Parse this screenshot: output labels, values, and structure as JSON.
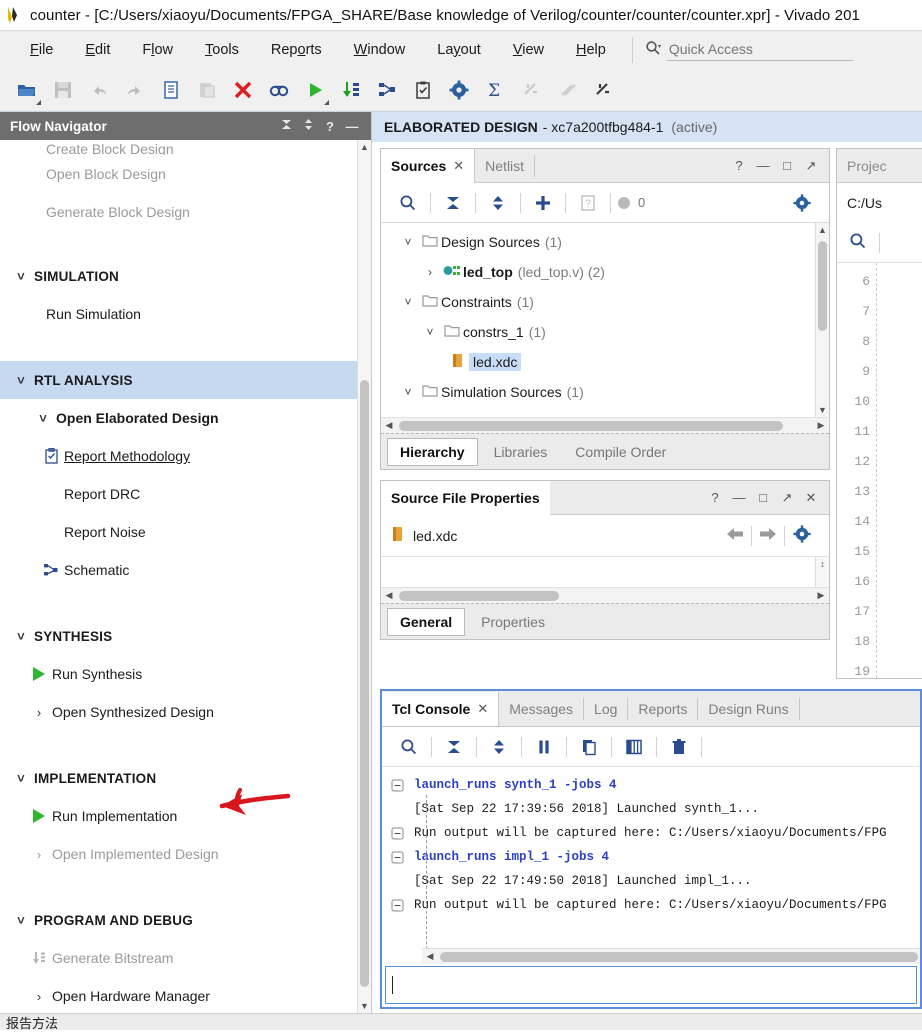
{
  "window": {
    "title": "counter - [C:/Users/xiaoyu/Documents/FPGA_SHARE/Base knowledge of Verilog/counter/counter/counter.xpr] - Vivado 201",
    "app_icon": "vivado-logo-icon"
  },
  "menubar": {
    "items": [
      {
        "label": "File",
        "mnemonic": "F"
      },
      {
        "label": "Edit",
        "mnemonic": "E"
      },
      {
        "label": "Flow",
        "mnemonic": "l"
      },
      {
        "label": "Tools",
        "mnemonic": "T"
      },
      {
        "label": "Reports",
        "mnemonic": "o"
      },
      {
        "label": "Window",
        "mnemonic": "W"
      },
      {
        "label": "Layout",
        "mnemonic": "y"
      },
      {
        "label": "View",
        "mnemonic": "V"
      },
      {
        "label": "Help",
        "mnemonic": "H"
      }
    ]
  },
  "quick_access": {
    "placeholder": "Quick Access",
    "value": "",
    "icon": "search-icon"
  },
  "toolbar": {
    "buttons": [
      {
        "name": "open-project-icon",
        "enabled": true
      },
      {
        "name": "save-icon",
        "enabled": false
      },
      {
        "name": "undo-icon",
        "enabled": false
      },
      {
        "name": "redo-icon",
        "enabled": false
      },
      {
        "name": "copy-icon",
        "enabled": true
      },
      {
        "name": "paste-icon",
        "enabled": false
      },
      {
        "name": "delete-icon",
        "enabled": true
      },
      {
        "name": "find-icon",
        "enabled": true
      },
      {
        "name": "run-icon",
        "enabled": true
      },
      {
        "name": "generate-bitstream-icon",
        "enabled": true
      },
      {
        "name": "schematic-icon",
        "enabled": true
      },
      {
        "name": "report-methodology-icon",
        "enabled": true
      },
      {
        "name": "settings-icon",
        "enabled": true
      },
      {
        "name": "sum-icon",
        "enabled": true
      },
      {
        "name": "mark-icon",
        "enabled": false
      },
      {
        "name": "slash-icon",
        "enabled": false
      },
      {
        "name": "scissors-icon",
        "enabled": true
      }
    ]
  },
  "flow_navigator": {
    "title": "Flow Navigator",
    "header_buttons": [
      "collapse-all-icon",
      "expand-collapse-icon",
      "help-icon",
      "minimize-icon"
    ],
    "clipped_top_item": "Create Block Design",
    "items": [
      {
        "label": "Open Block Design",
        "indent": 1,
        "state": "disabled",
        "icon": "none",
        "chevron": "none"
      },
      {
        "label": "Generate Block Design",
        "indent": 1,
        "state": "disabled",
        "icon": "none",
        "chevron": "none"
      },
      {
        "label": "SIMULATION",
        "indent": 0,
        "state": "section",
        "icon": "none",
        "chevron": "down"
      },
      {
        "label": "Run Simulation",
        "indent": 1,
        "state": "normal",
        "icon": "none",
        "chevron": "none"
      },
      {
        "label": "RTL ANALYSIS",
        "indent": 0,
        "state": "section-active",
        "icon": "none",
        "chevron": "down"
      },
      {
        "label": "Open Elaborated Design",
        "indent": 1,
        "state": "bold",
        "icon": "none",
        "chevron": "down"
      },
      {
        "label": "Report Methodology",
        "indent": 2,
        "state": "link",
        "icon": "clipboard-check-icon",
        "chevron": "none"
      },
      {
        "label": "Report DRC",
        "indent": 2,
        "state": "normal",
        "icon": "none",
        "chevron": "none"
      },
      {
        "label": "Report Noise",
        "indent": 2,
        "state": "normal",
        "icon": "none",
        "chevron": "none"
      },
      {
        "label": "Schematic",
        "indent": 2,
        "state": "normal",
        "icon": "schematic-icon",
        "chevron": "none"
      },
      {
        "label": "SYNTHESIS",
        "indent": 0,
        "state": "section",
        "icon": "none",
        "chevron": "down"
      },
      {
        "label": "Run Synthesis",
        "indent": 1,
        "state": "normal",
        "icon": "green-play-icon",
        "chevron": "none"
      },
      {
        "label": "Open Synthesized Design",
        "indent": 1,
        "state": "normal",
        "icon": "none",
        "chevron": "right"
      },
      {
        "label": "IMPLEMENTATION",
        "indent": 0,
        "state": "section",
        "icon": "none",
        "chevron": "down"
      },
      {
        "label": "Run Implementation",
        "indent": 1,
        "state": "normal",
        "icon": "green-play-icon",
        "chevron": "none"
      },
      {
        "label": "Open Implemented Design",
        "indent": 1,
        "state": "disabled",
        "icon": "none",
        "chevron": "right"
      },
      {
        "label": "PROGRAM AND DEBUG",
        "indent": 0,
        "state": "section",
        "icon": "none",
        "chevron": "down"
      },
      {
        "label": "Generate Bitstream",
        "indent": 1,
        "state": "disabled",
        "icon": "bitstream-icon",
        "chevron": "none"
      },
      {
        "label": "Open Hardware Manager",
        "indent": 1,
        "state": "normal",
        "icon": "none",
        "chevron": "right"
      }
    ]
  },
  "workspace_banner": {
    "label": "ELABORATED DESIGN",
    "part": "- xc7a200tfbg484-1",
    "state": "(active)"
  },
  "sources_panel": {
    "tabs": [
      {
        "label": "Sources",
        "active": true,
        "closable": true
      },
      {
        "label": "Netlist",
        "active": false,
        "closable": false
      }
    ],
    "header_buttons": [
      "help-icon",
      "minimize-icon",
      "maximize-icon",
      "float-icon"
    ],
    "toolbar": [
      "search-icon",
      "collapse-all-icon",
      "expand-all-icon",
      "add-sources-icon",
      "unknown-icon",
      "status-dot-icon",
      "settings-icon"
    ],
    "status_count": "0",
    "tree": [
      {
        "label": "Design Sources",
        "suffix": "(1)",
        "depth": 0,
        "arrow": "down",
        "icon": "folder-icon",
        "bold": false,
        "selected": false
      },
      {
        "label": "led_top",
        "suffix": "(led_top.v) (2)",
        "depth": 1,
        "arrow": "right",
        "icon": "module-icon",
        "bold": true,
        "selected": false
      },
      {
        "label": "Constraints",
        "suffix": "(1)",
        "depth": 0,
        "arrow": "down",
        "icon": "folder-icon",
        "bold": false,
        "selected": false
      },
      {
        "label": "constrs_1",
        "suffix": "(1)",
        "depth": 1,
        "arrow": "down",
        "icon": "folder-icon",
        "bold": false,
        "selected": false
      },
      {
        "label": "led.xdc",
        "suffix": "",
        "depth": 2,
        "arrow": "none",
        "icon": "xdc-file-icon",
        "bold": false,
        "selected": true
      },
      {
        "label": "Simulation Sources",
        "suffix": "(1)",
        "depth": 0,
        "arrow": "down",
        "icon": "folder-icon",
        "bold": false,
        "selected": false
      }
    ],
    "bottom_tabs": [
      {
        "label": "Hierarchy",
        "active": true
      },
      {
        "label": "Libraries",
        "active": false
      },
      {
        "label": "Compile Order",
        "active": false
      }
    ]
  },
  "source_file_properties": {
    "title": "Source File Properties",
    "header_buttons": [
      "help-icon",
      "minimize-icon",
      "maximize-icon",
      "float-icon",
      "close-icon"
    ],
    "file_name": "led.xdc",
    "file_icon": "xdc-file-icon",
    "nav_buttons": [
      "back-arrow-icon",
      "forward-arrow-icon",
      "settings-icon"
    ],
    "bottom_tabs": [
      {
        "label": "General",
        "active": true
      },
      {
        "label": "Properties",
        "active": false
      }
    ]
  },
  "project_panel": {
    "title": "Projec",
    "path": "C:/Us",
    "toolbar": [
      "search-icon"
    ],
    "line_numbers": [
      "6",
      "7",
      "8",
      "9",
      "10",
      "11",
      "12",
      "13",
      "14",
      "15",
      "16",
      "17",
      "18",
      "19"
    ]
  },
  "tcl_console": {
    "tabs": [
      {
        "label": "Tcl Console",
        "active": true,
        "closable": true
      },
      {
        "label": "Messages",
        "active": false,
        "closable": false
      },
      {
        "label": "Log",
        "active": false,
        "closable": false
      },
      {
        "label": "Reports",
        "active": false,
        "closable": false
      },
      {
        "label": "Design Runs",
        "active": false,
        "closable": false
      }
    ],
    "toolbar": [
      "search-icon",
      "collapse-all-icon",
      "expand-all-icon",
      "pause-icon",
      "copy-icon",
      "table-icon",
      "trash-icon"
    ],
    "lines": [
      {
        "text": "launch_runs synth_1 -jobs 4",
        "kind": "cmd",
        "marker": "collapse"
      },
      {
        "text": "[Sat Sep 22 17:39:56 2018] Launched synth_1...",
        "kind": "out",
        "marker": "none"
      },
      {
        "text": "Run output will be captured here: C:/Users/xiaoyu/Documents/FPG",
        "kind": "out",
        "marker": "collapse"
      },
      {
        "text": "launch_runs impl_1 -jobs 4",
        "kind": "cmd",
        "marker": "collapse"
      },
      {
        "text": "[Sat Sep 22 17:49:50 2018] Launched impl_1...",
        "kind": "out",
        "marker": "none"
      },
      {
        "text": "Run output will be captured here: C:/Users/xiaoyu/Documents/FPG",
        "kind": "out",
        "marker": "collapse"
      }
    ],
    "input_value": "",
    "input_placeholder": ""
  },
  "status_bar": {
    "text": "报告方法"
  },
  "annotation": {
    "type": "red-arrow",
    "points_at": "Run Implementation",
    "color": "#d8161c"
  },
  "colors": {
    "accent_blue": "#2b4c8c",
    "banner_blue": "#d6e3f5",
    "selection_blue": "#c5d9f1",
    "green_play": "#2db52d",
    "annotation_red": "#d8161c",
    "panel_header_gray": "#ebebeb",
    "flownav_header_gray": "#6e6e6e"
  }
}
